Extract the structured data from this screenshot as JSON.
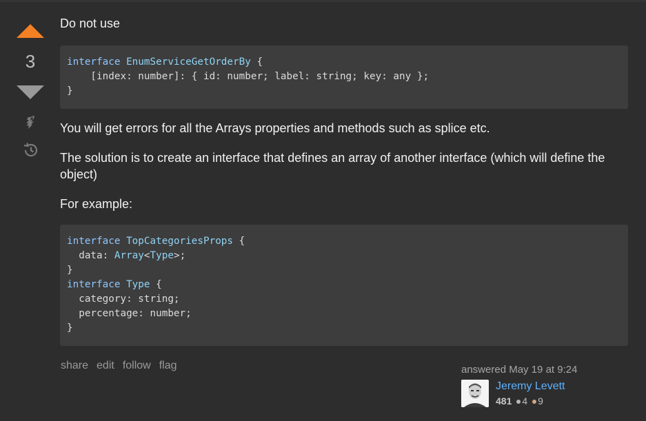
{
  "vote": {
    "count": "3"
  },
  "answer": {
    "intro": "Do not use",
    "code1": [
      [
        [
          "kw",
          "interface "
        ],
        [
          "ty",
          "EnumServiceGetOrderBy"
        ],
        [
          "",
          " {"
        ]
      ],
      [
        [
          "",
          "    [index: number]: { id: number; label: string; key: any };"
        ]
      ],
      [
        [
          "",
          "}"
        ]
      ]
    ],
    "para_errors": "You will get errors for all the Arrays properties and methods such as splice etc.",
    "para_solution": "The solution is to create an interface that defines an array of another interface (which will define the object)",
    "para_example": "For example:",
    "code2": [
      [
        [
          "kw",
          "interface "
        ],
        [
          "ty",
          "TopCategoriesProps"
        ],
        [
          "",
          " {"
        ]
      ],
      [
        [
          "",
          "  data: "
        ],
        [
          "ty",
          "Array"
        ],
        [
          "",
          "<"
        ],
        [
          "ty",
          "Type"
        ],
        [
          "",
          ">;"
        ]
      ],
      [
        [
          "",
          "}"
        ]
      ],
      [
        [
          "kw",
          "interface "
        ],
        [
          "ty",
          "Type"
        ],
        [
          "",
          " {"
        ]
      ],
      [
        [
          "",
          "  category: string;"
        ]
      ],
      [
        [
          "",
          "  percentage: number;"
        ]
      ],
      [
        [
          "",
          "}"
        ]
      ]
    ]
  },
  "menu": {
    "share": "share",
    "edit": "edit",
    "follow": "follow",
    "flag": "flag"
  },
  "user": {
    "answered": "answered May 19 at 9:24",
    "name": "Jeremy Levett",
    "reputation": "481",
    "silver": "4",
    "bronze": "9"
  },
  "colors": {
    "background": "#2d2d2d",
    "code_background": "#3d3d3d",
    "upvote": "#f48024",
    "link": "#5eb1ff",
    "keyword": "#8fc7ff"
  },
  "icons": [
    "upvote-arrow-icon",
    "downvote-arrow-icon",
    "bounty-icon",
    "history-icon"
  ]
}
